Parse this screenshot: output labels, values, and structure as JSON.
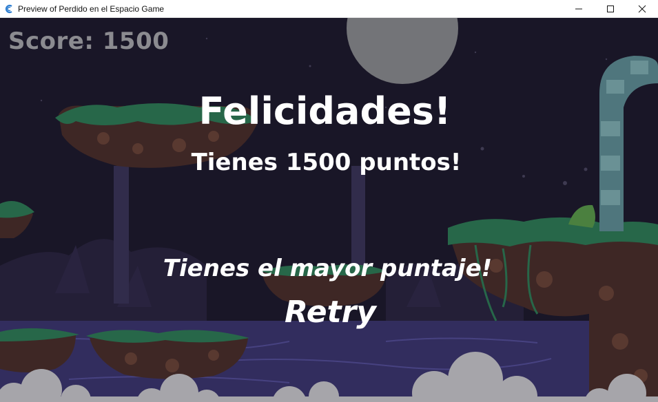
{
  "window": {
    "title": "Preview of Perdido en el Espacio Game",
    "controls": [
      "minimize-icon",
      "maximize-icon",
      "close-icon"
    ]
  },
  "hud": {
    "score_text": "Score: 1500"
  },
  "end_screen": {
    "congrats": "Felicidades!",
    "points_text": "Tienes 1500 puntos!",
    "highscore_text": "Tienes el mayor puntaje!",
    "retry_label": "Retry"
  },
  "colors": {
    "sky": "#1d1a2c",
    "moon": "#8a8d8f",
    "grass": "#2e7d56",
    "dirt": "#4a2f2a",
    "water": "#3b3670",
    "clouds": "#c9c9cc",
    "portal": "#7fb0b2"
  }
}
